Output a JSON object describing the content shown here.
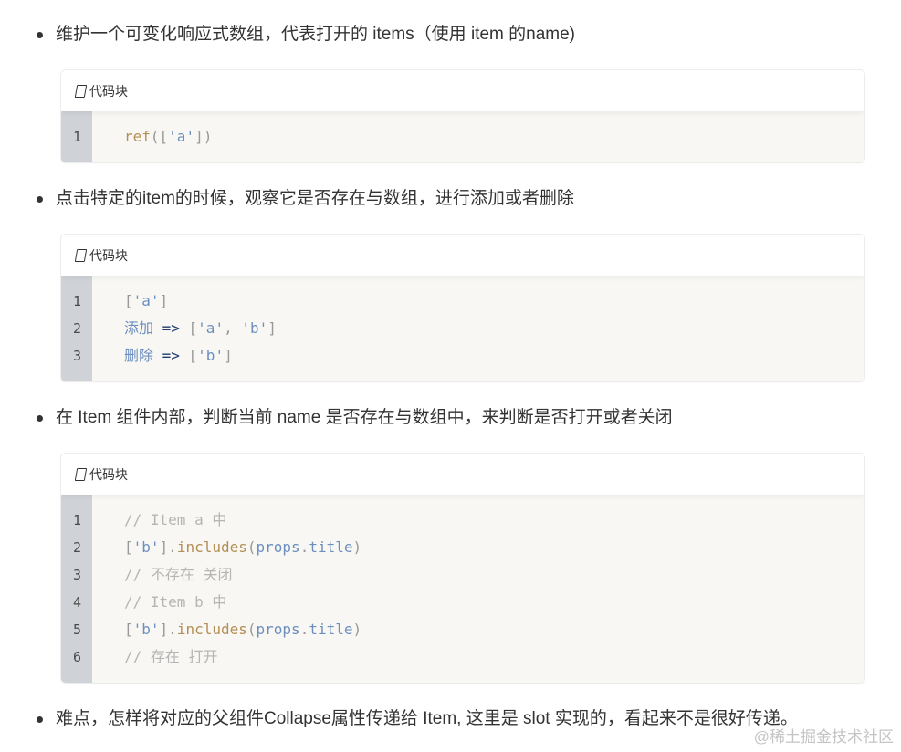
{
  "bullets": [
    "维护一个可变化响应式数组，代表打开的 items（使用 item 的name)",
    "点击特定的item的时候，观察它是否存在与数组，进行添加或者删除",
    "在 Item 组件内部，判断当前 name 是否存在与数组中，来判断是否打开或者关闭",
    "难点，怎样将对应的父组件Collapse属性传递给 Item, 这里是 slot 实现的，看起来不是很好传递。"
  ],
  "code_header_label": "代码块",
  "code_blocks": [
    {
      "line_numbers": [
        "1"
      ],
      "lines": [
        [
          {
            "t": "ref",
            "c": "fn"
          },
          {
            "t": "([",
            "c": "punc"
          },
          {
            "t": "'a'",
            "c": "str"
          },
          {
            "t": "])",
            "c": "punc"
          }
        ]
      ]
    },
    {
      "line_numbers": [
        "1",
        "2",
        "3"
      ],
      "lines": [
        [
          {
            "t": "[",
            "c": "punc"
          },
          {
            "t": "'a'",
            "c": "str"
          },
          {
            "t": "]",
            "c": "punc"
          }
        ],
        [
          {
            "t": "添加 ",
            "c": "str"
          },
          {
            "t": "=>",
            "c": "op"
          },
          {
            "t": " [",
            "c": "punc"
          },
          {
            "t": "'a'",
            "c": "str"
          },
          {
            "t": ", ",
            "c": "punc"
          },
          {
            "t": "'b'",
            "c": "str"
          },
          {
            "t": "]",
            "c": "punc"
          }
        ],
        [
          {
            "t": "删除 ",
            "c": "str"
          },
          {
            "t": "=>",
            "c": "op"
          },
          {
            "t": " [",
            "c": "punc"
          },
          {
            "t": "'b'",
            "c": "str"
          },
          {
            "t": "]",
            "c": "punc"
          }
        ]
      ]
    },
    {
      "line_numbers": [
        "1",
        "2",
        "3",
        "4",
        "5",
        "6"
      ],
      "lines": [
        [
          {
            "t": "// Item a 中",
            "c": "cm"
          }
        ],
        [
          {
            "t": "[",
            "c": "punc"
          },
          {
            "t": "'b'",
            "c": "str"
          },
          {
            "t": "].",
            "c": "punc"
          },
          {
            "t": "includes",
            "c": "fn"
          },
          {
            "t": "(",
            "c": "punc"
          },
          {
            "t": "props",
            "c": "prop"
          },
          {
            "t": ".",
            "c": "punc"
          },
          {
            "t": "title",
            "c": "prop"
          },
          {
            "t": ")",
            "c": "punc"
          }
        ],
        [
          {
            "t": "// 不存在 关闭",
            "c": "cm"
          }
        ],
        [
          {
            "t": "// Item b 中",
            "c": "cm"
          }
        ],
        [
          {
            "t": "[",
            "c": "punc"
          },
          {
            "t": "'b'",
            "c": "str"
          },
          {
            "t": "].",
            "c": "punc"
          },
          {
            "t": "includes",
            "c": "fn"
          },
          {
            "t": "(",
            "c": "punc"
          },
          {
            "t": "props",
            "c": "prop"
          },
          {
            "t": ".",
            "c": "punc"
          },
          {
            "t": "title",
            "c": "prop"
          },
          {
            "t": ")",
            "c": "punc"
          }
        ],
        [
          {
            "t": "// 存在 打开",
            "c": "cm"
          }
        ]
      ]
    }
  ],
  "watermark": "@稀土掘金技术社区",
  "colors": {
    "text": "#333333",
    "code_bg": "#f8f7f3",
    "gutter_bg": "#cfd3d7",
    "function": "#b48f56",
    "string": "#6c8fc0",
    "comment": "#b5b5b5"
  }
}
